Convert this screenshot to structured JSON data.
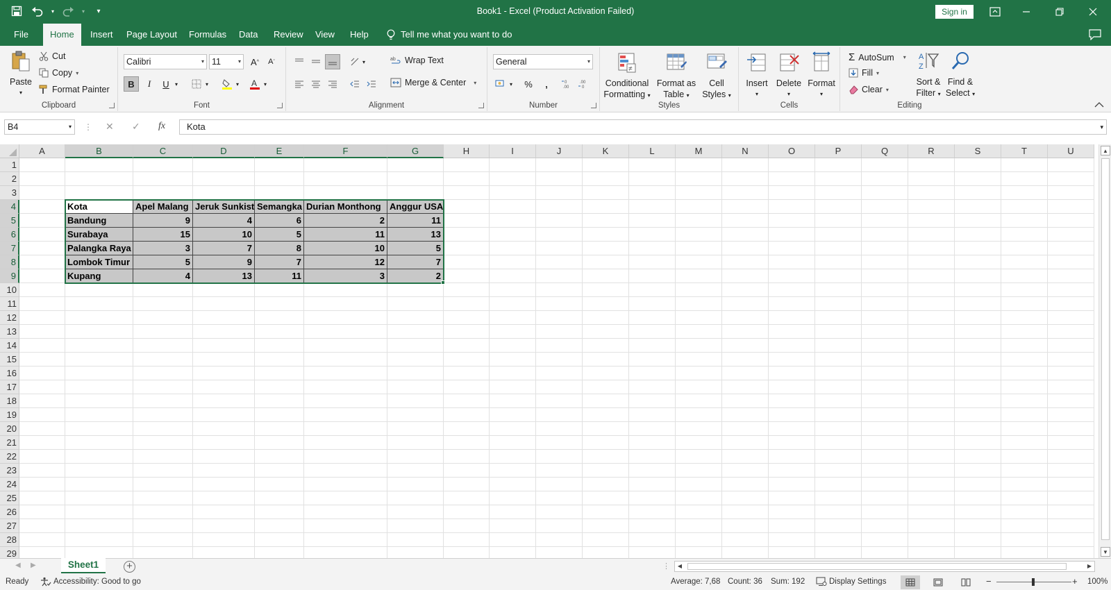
{
  "titlebar": {
    "title": "Book1  -  Excel (Product Activation Failed)",
    "sign_in": "Sign in",
    "icons": [
      "save-icon",
      "undo-icon",
      "redo-icon",
      "customize-qat-icon",
      "ribbon-display-icon",
      "minimize-icon",
      "restore-icon",
      "close-icon"
    ]
  },
  "tabs": {
    "items": [
      "File",
      "Home",
      "Insert",
      "Page Layout",
      "Formulas",
      "Data",
      "Review",
      "View",
      "Help"
    ],
    "active": "Home",
    "tell_me": "Tell me what you want to do"
  },
  "ribbon": {
    "clipboard": {
      "name": "Clipboard",
      "paste": "Paste",
      "cut": "Cut",
      "copy": "Copy",
      "format_painter": "Format Painter"
    },
    "font": {
      "name": "Font",
      "font_name": "Calibri",
      "font_size": "11",
      "bold": "B",
      "italic": "I",
      "underline": "U"
    },
    "alignment": {
      "name": "Alignment",
      "wrap_text": "Wrap Text",
      "merge_center": "Merge & Center"
    },
    "number": {
      "name": "Number",
      "format": "General",
      "percent": "%",
      "comma": ","
    },
    "styles": {
      "name": "Styles",
      "conditional_1": "Conditional",
      "conditional_2": "Formatting",
      "format_table_1": "Format as",
      "format_table_2": "Table",
      "cell_styles_1": "Cell",
      "cell_styles_2": "Styles"
    },
    "cells": {
      "name": "Cells",
      "insert": "Insert",
      "delete": "Delete",
      "format": "Format"
    },
    "editing": {
      "name": "Editing",
      "autosum": "AutoSum",
      "fill": "Fill",
      "clear": "Clear",
      "sort_1": "Sort &",
      "sort_2": "Filter",
      "find_1": "Find &",
      "find_2": "Select"
    }
  },
  "formula_bar": {
    "name_box": "B4",
    "fx": "fx",
    "content": "Kota"
  },
  "grid": {
    "columns": [
      "A",
      "B",
      "C",
      "D",
      "E",
      "F",
      "G",
      "H",
      "I",
      "J",
      "K",
      "L",
      "M",
      "N",
      "O",
      "P",
      "Q",
      "R",
      "S",
      "T",
      "U"
    ],
    "selected_columns": [
      "B",
      "C",
      "D",
      "E",
      "F",
      "G"
    ],
    "rows": [
      "1",
      "2",
      "3",
      "4",
      "5",
      "6",
      "7",
      "8",
      "9",
      "10",
      "11",
      "12",
      "13",
      "14",
      "15",
      "16",
      "17",
      "18",
      "19",
      "20",
      "21",
      "22",
      "23",
      "24",
      "25",
      "26",
      "27",
      "28",
      "29"
    ],
    "selected_rows": [
      "4",
      "5",
      "6",
      "7",
      "8",
      "9"
    ],
    "active_cell": "B4"
  },
  "table": {
    "headers": [
      "Kota",
      "Apel Malang",
      "Jeruk Sunkist",
      "Semangka",
      "Durian Monthong",
      "Anggur USA"
    ],
    "rows": [
      [
        "Bandung",
        "9",
        "4",
        "6",
        "2",
        "11"
      ],
      [
        "Surabaya",
        "15",
        "10",
        "5",
        "11",
        "13"
      ],
      [
        "Palangka Raya",
        "3",
        "7",
        "8",
        "10",
        "5"
      ],
      [
        "Lombok Timur",
        "5",
        "9",
        "7",
        "12",
        "7"
      ],
      [
        "Kupang",
        "4",
        "13",
        "11",
        "3",
        "2"
      ]
    ]
  },
  "sheets": {
    "active": "Sheet1",
    "add": "+"
  },
  "status": {
    "ready": "Ready",
    "accessibility": "Accessibility: Good to go",
    "average": "Average: 7,68",
    "count": "Count: 36",
    "sum": "Sum: 192",
    "display_settings": "Display Settings",
    "zoom": "100%",
    "zoom_minus": "−",
    "zoom_plus": "+"
  },
  "colors": {
    "accent": "#217346",
    "selection_fill": "#c8c8c8",
    "header_fill": "#e6e6e6"
  }
}
